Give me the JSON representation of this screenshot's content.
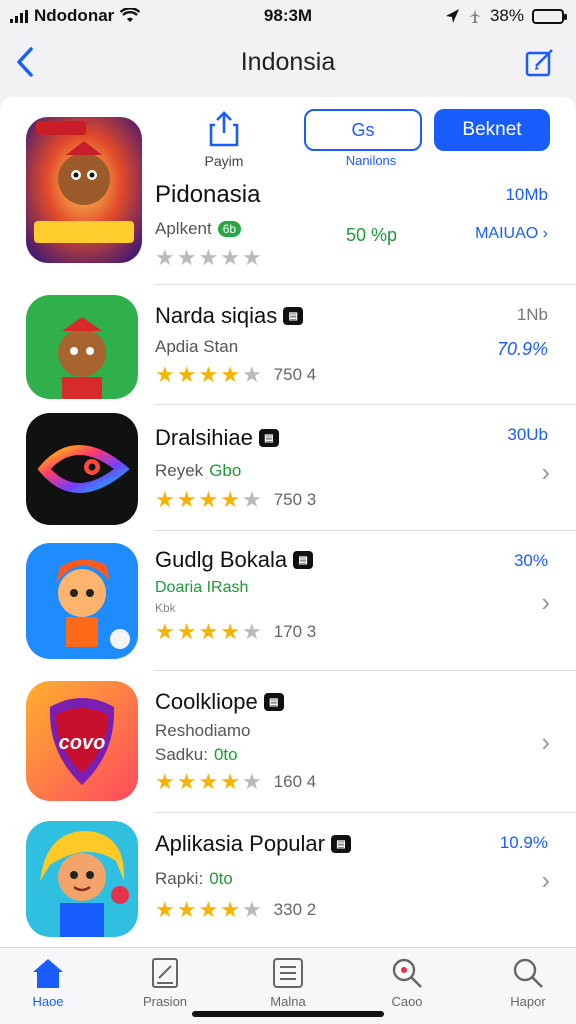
{
  "status": {
    "carrier": "Ndodonar",
    "time": "98:3M",
    "battery": "38%",
    "battery_level": 0.38
  },
  "nav": {
    "title": "Indonsia",
    "back_icon": "chevron-left-icon",
    "compose_icon": "compose-icon"
  },
  "actions": {
    "share_label": "Payim",
    "outline_button": "Gs",
    "outline_label": "Nanilons",
    "fill_button": "Beknet"
  },
  "featured": {
    "name": "Pidonasia",
    "subtitle": "Aplkent",
    "subtitle_pill": "6b",
    "size": "10Mb",
    "percent": "50 %p",
    "link": "MAIUAO",
    "rating": 0
  },
  "apps": [
    {
      "name": "Narda siqias",
      "subtitle": "Apdia Stan",
      "rating": 4,
      "count": "750 4",
      "size": "1Nb",
      "percent": "70.9%"
    },
    {
      "name": "Dralsihiae",
      "subtitle": "Reyek",
      "subtitle_green": "Gbo",
      "rating": 4,
      "count": "750 3",
      "size": "30Ub"
    },
    {
      "name": "Gudlg Bokala",
      "subtitle": "Doaria IRash",
      "subtitle2": "Kbk",
      "rating": 4,
      "count": "170 3",
      "size": "30%"
    },
    {
      "name": "Coolkliope",
      "subtitle": "Reshodiamo",
      "subtitle2": "Sadku:",
      "subtitle2_green": "0to",
      "rating": 4,
      "count": "160 4"
    },
    {
      "name": "Aplikasia Popular",
      "subtitle": "Rapki:",
      "subtitle_green": "0to",
      "rating": 4,
      "count": "330 2",
      "size": "10.9%"
    }
  ],
  "tabs": [
    {
      "label": "Haoe",
      "icon": "home-icon",
      "active": true
    },
    {
      "label": "Prasion",
      "icon": "notes-icon"
    },
    {
      "label": "Malna",
      "icon": "list-icon"
    },
    {
      "label": "Caoo",
      "icon": "search-icon"
    },
    {
      "label": "Hapor",
      "icon": "search-icon"
    }
  ],
  "colors": {
    "accent": "#1a5dff",
    "green": "#1e9a3a",
    "star": "#f5b400"
  }
}
